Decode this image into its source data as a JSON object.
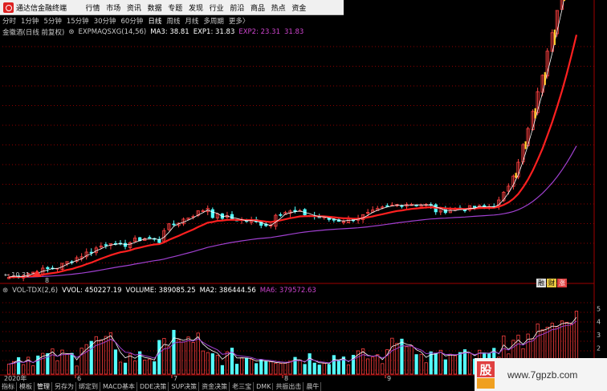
{
  "menubar": {
    "title": "通达信金融终端",
    "items": [
      "行情",
      "市场",
      "资讯",
      "数据",
      "专题",
      "发现",
      "行业",
      "前沿",
      "商品",
      "热点",
      "资金"
    ]
  },
  "periods": {
    "items": [
      "分时",
      "1分钟",
      "5分钟",
      "15分钟",
      "30分钟",
      "60分钟",
      "日线",
      "周线",
      "月线",
      "多周期",
      "更多〉"
    ],
    "active": "日线"
  },
  "main_indicator": {
    "name": "金徽酒(日线 前复权)",
    "formula": "EXPMAQSXG(14,56)",
    "ma3": "MA3: 38.81",
    "exp1": "EXP1: 31.83",
    "exp2": "EXP2: 23.31",
    "extra": "31.83",
    "colors": {
      "ma3": "#ffffff",
      "exp1": "#ffffff",
      "exp2": "#cc44cc",
      "extra": "#cc44cc"
    }
  },
  "volume_indicator": {
    "name": "VOL-TDX(2,6)",
    "vvol": "VVOL: 450227.19",
    "volume": "VOLUME: 389085.25",
    "ma2": "MA2: 386444.56",
    "ma6": "MA6: 379572.63",
    "colors": {
      "ma6": "#cc44cc"
    }
  },
  "price_marker": "10.31",
  "low_marker_num": "8",
  "vol_axis_ticks": [
    "5",
    "4",
    "3",
    "2",
    "1"
  ],
  "time_axis": {
    "year": "2020年",
    "months": [
      "6",
      "7",
      "8",
      "9"
    ]
  },
  "badges": [
    "融",
    "财",
    "涨"
  ],
  "bottom_tabs": [
    "指标",
    "模板",
    "管理",
    "另存为",
    "绑定到",
    "MACD基本",
    "DDE决策",
    "SUP决策",
    "资金决策",
    "老三宝",
    "DMK",
    "共振出击",
    "晨牛"
  ],
  "bottom_active": "管理",
  "watermark": {
    "text": "www.7gpzb.com",
    "logo_text": "股"
  },
  "colors": {
    "up": "#ff4040",
    "down": "#54ffff",
    "ema_fast": "#ff2020",
    "ema_slow": "#a040d0",
    "signal": "#ffd030",
    "grid": "#8b0000"
  }
}
